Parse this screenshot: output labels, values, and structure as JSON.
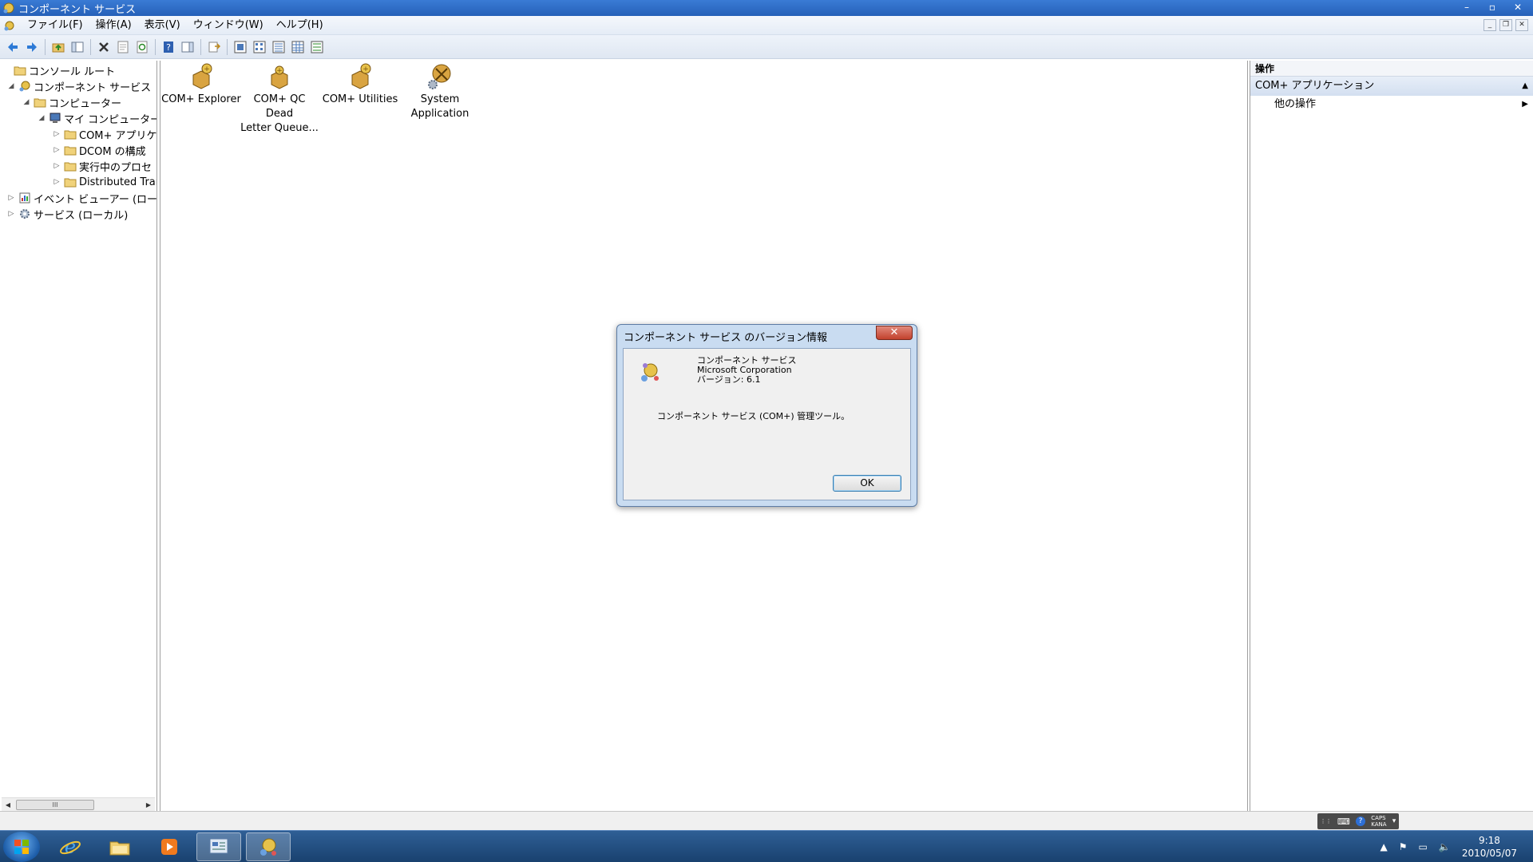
{
  "window": {
    "title": "コンポーネント サービス",
    "controls": {
      "minimize": "–",
      "maximize": "▫",
      "close": "✕"
    }
  },
  "menu": {
    "items": [
      "ファイル(F)",
      "操作(A)",
      "表示(V)",
      "ウィンドウ(W)",
      "ヘルプ(H)"
    ]
  },
  "tree": {
    "nodes": [
      {
        "label": "コンソール ルート",
        "expander": ""
      },
      {
        "label": "コンポーネント サービス",
        "expander": "◢"
      },
      {
        "label": "コンピューター",
        "expander": "◢"
      },
      {
        "label": "マイ コンピューター",
        "expander": "◢"
      },
      {
        "label": "COM+ アプリケ",
        "expander": "▷"
      },
      {
        "label": "DCOM の構成",
        "expander": "▷"
      },
      {
        "label": "実行中のプロセ",
        "expander": "▷"
      },
      {
        "label": "Distributed Trar",
        "expander": "▷"
      },
      {
        "label": "イベント ビューアー (ロー",
        "expander": "▷"
      },
      {
        "label": "サービス (ローカル)",
        "expander": "▷"
      }
    ],
    "scroll_thumb": "III"
  },
  "content": {
    "icons": [
      {
        "line1": "COM+ Explorer",
        "line2": ""
      },
      {
        "line1": "COM+ QC Dead",
        "line2": "Letter Queue..."
      },
      {
        "line1": "COM+ Utilities",
        "line2": ""
      },
      {
        "line1": "System",
        "line2": "Application"
      }
    ]
  },
  "actions": {
    "header": "操作",
    "section": "COM+ アプリケーション",
    "section_caret": "▲",
    "items": [
      {
        "label": "他の操作",
        "caret": "▶"
      }
    ]
  },
  "dialog": {
    "title": "コンポーネント サービス のバージョン情報",
    "close": "✕",
    "product": "コンポーネント サービス",
    "company": "Microsoft Corporation",
    "version": "バージョン: 6.1",
    "description": "コンポーネント サービス (COM+) 管理ツール。",
    "ok": "OK"
  },
  "statusbar": {
    "langbar": {
      "caps": "CAPS",
      "kana": "KANA"
    }
  },
  "taskbar": {
    "time": "9:18",
    "date": "2010/05/07"
  },
  "colors": {
    "titlebar": "#2a66c0",
    "taskbar": "#1f4a7d",
    "dialog_frame": "#c9dcf1",
    "close_button": "#c2412d"
  }
}
